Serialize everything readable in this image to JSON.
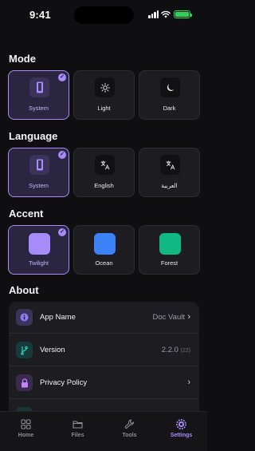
{
  "status_bar": {
    "time": "9:41"
  },
  "sections": {
    "mode": {
      "title": "Mode",
      "options": [
        {
          "label": "System",
          "icon": "phone-icon",
          "selected": true
        },
        {
          "label": "Light",
          "icon": "sun-icon",
          "selected": false
        },
        {
          "label": "Dark",
          "icon": "moon-icon",
          "selected": false
        }
      ]
    },
    "language": {
      "title": "Language",
      "options": [
        {
          "label": "System",
          "icon": "phone-icon",
          "selected": true
        },
        {
          "label": "English",
          "icon": "translate-icon",
          "selected": false
        },
        {
          "label": "العربية",
          "icon": "translate-icon",
          "selected": false
        }
      ]
    },
    "accent": {
      "title": "Accent",
      "options": [
        {
          "label": "Twilight",
          "color": "#a78bfa",
          "selected": true
        },
        {
          "label": "Ocean",
          "color": "#3b82f6",
          "selected": false
        },
        {
          "label": "Forest",
          "color": "#10b981",
          "selected": false
        }
      ]
    },
    "about": {
      "title": "About",
      "rows": [
        {
          "label": "App Name",
          "value": "Doc Vault",
          "icon": "info-icon",
          "icon_color": "#8b7cf6"
        },
        {
          "label": "Version",
          "value": "2.2.0",
          "value_sub": "(22)",
          "icon": "branch-icon",
          "icon_color": "#2dd4bf"
        },
        {
          "label": "Privacy Policy",
          "value": "",
          "icon": "lock-icon",
          "icon_color": "#c084fc"
        }
      ]
    }
  },
  "tabs": [
    {
      "label": "Home",
      "icon": "grid-icon",
      "active": false
    },
    {
      "label": "Files",
      "icon": "folder-icon",
      "active": false
    },
    {
      "label": "Tools",
      "icon": "wrench-icon",
      "active": false
    },
    {
      "label": "Settings",
      "icon": "gear-icon",
      "active": true
    }
  ],
  "colors": {
    "accent": "#a78bfa",
    "background": "#0f0f12",
    "card": "#1d1d21"
  }
}
